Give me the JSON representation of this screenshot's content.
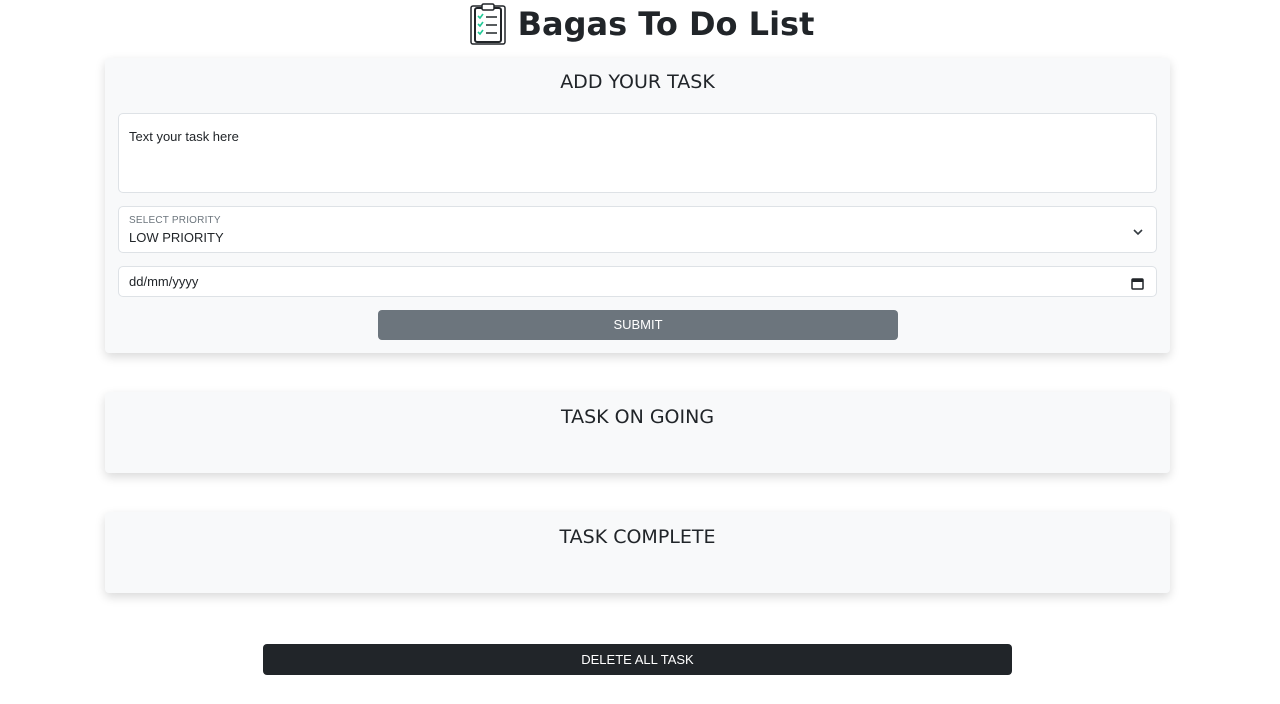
{
  "header": {
    "title": "Bagas To Do List",
    "icon": "clipboard-checklist-icon"
  },
  "add_task": {
    "heading": "ADD YOUR TASK",
    "textarea_placeholder": "Text your task here",
    "priority_label": "SELECT PRIORITY",
    "priority_value": "LOW PRIORITY",
    "date_placeholder": "dd/mm/yyyy",
    "submit_label": "SUBMIT"
  },
  "ongoing": {
    "heading": "TASK ON GOING"
  },
  "complete": {
    "heading": "TASK COMPLETE"
  },
  "actions": {
    "delete_all_label": "DELETE ALL TASK"
  },
  "colors": {
    "card_bg": "#f8f9fa",
    "submit_bg": "#6c757d",
    "delete_bg": "#212529",
    "checkmark": "#20c997"
  }
}
